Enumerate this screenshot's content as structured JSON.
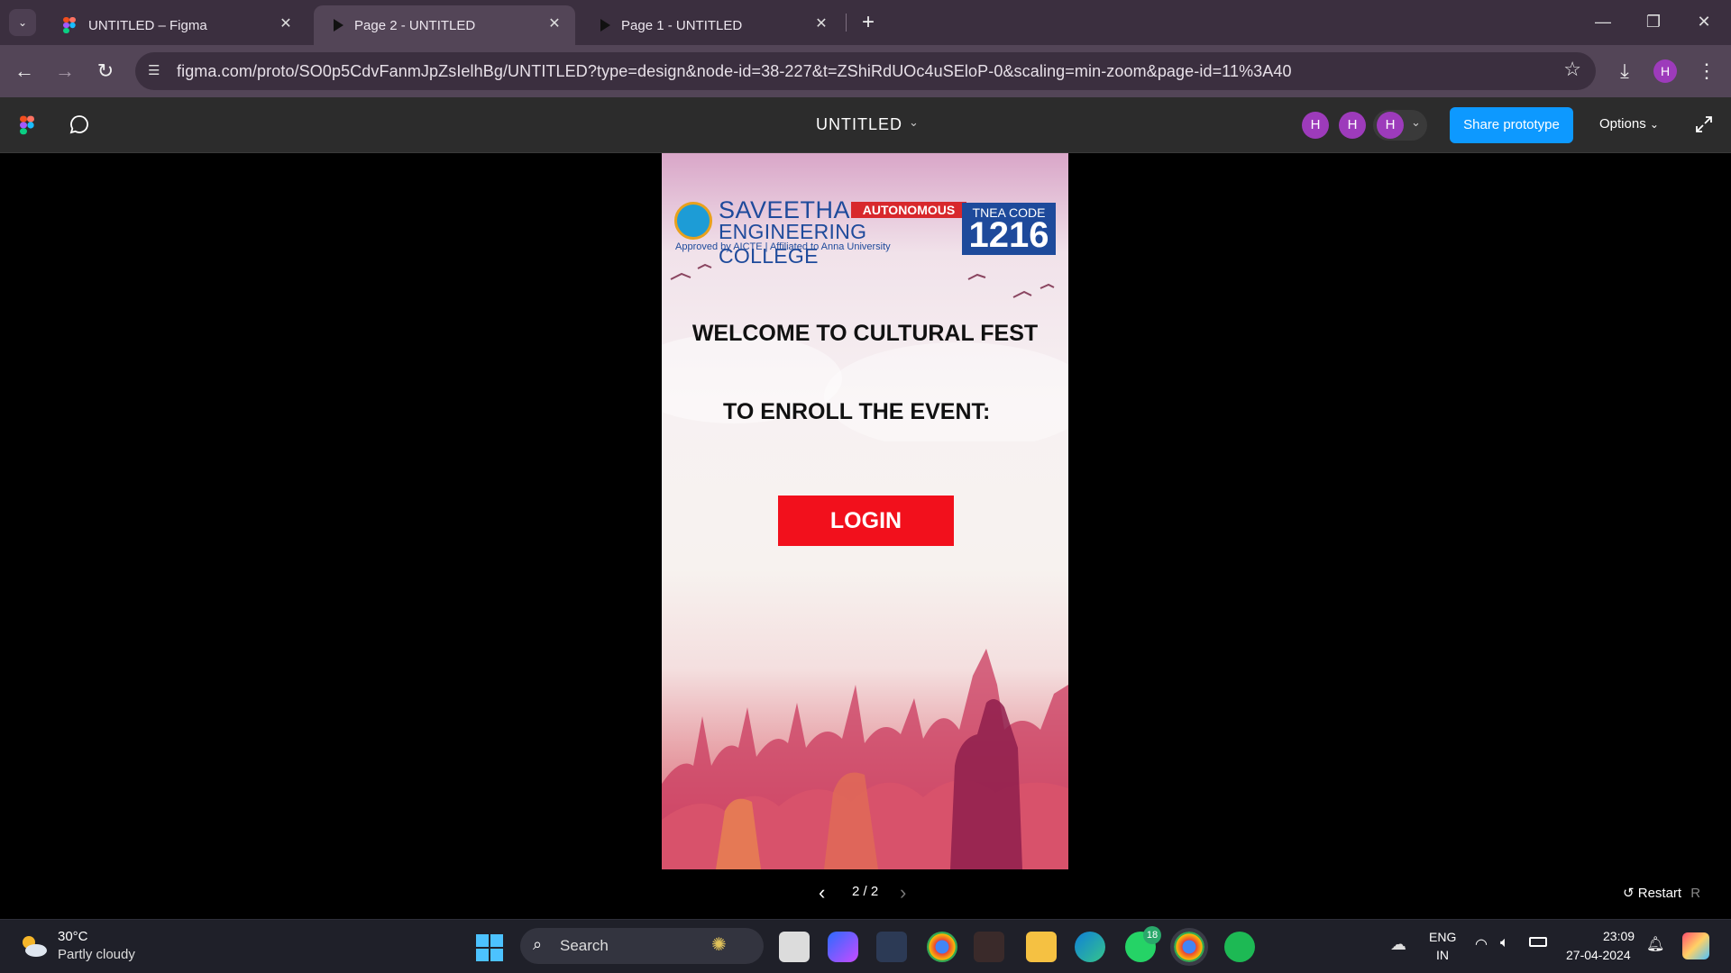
{
  "browser": {
    "tabs": [
      {
        "title": "UNTITLED – Figma",
        "active": false
      },
      {
        "title": "Page 2 - UNTITLED",
        "active": true
      },
      {
        "title": "Page 1 - UNTITLED",
        "active": false
      }
    ],
    "url": "figma.com/proto/SO0p5CdvFanmJpZsIelhBg/UNTITLED?type=design&node-id=38-227&t=ZShiRdUOc4uSEloP-0&scaling=min-zoom&page-id=11%3A40",
    "profile_initial": "H"
  },
  "figma": {
    "file_title": "UNTITLED",
    "collaborators": [
      "H",
      "H",
      "H"
    ],
    "share_label": "Share prototype",
    "options_label": "Options"
  },
  "prototype": {
    "college_name_line1": "SAVEETHA",
    "college_name_line2": "ENGINEERING COLLEGE",
    "autonomous_badge": "AUTONOMOUS",
    "approval_text": "Approved by AICTE | Affiliated to Anna University",
    "tnea_label": "TNEA CODE",
    "tnea_code": "1216",
    "welcome_text": "WELCOME TO CULTURAL FEST",
    "enroll_text": "TO ENROLL THE EVENT:",
    "login_label": "LOGIN"
  },
  "viewer": {
    "page_indicator": "2 / 2",
    "restart_label": "Restart",
    "restart_shortcut": "R"
  },
  "taskbar": {
    "temperature": "30°C",
    "weather": "Partly cloudy",
    "search_label": "Search",
    "whatsapp_badge": "18",
    "lang_line1": "ENG",
    "lang_line2": "IN",
    "time": "23:09",
    "date": "27-04-2024"
  },
  "colors": {
    "figma_share": "#0d99ff",
    "login_button": "#f2101c",
    "college_blue": "#1e4a9b",
    "avatar_purple": "#9d3bbb"
  }
}
